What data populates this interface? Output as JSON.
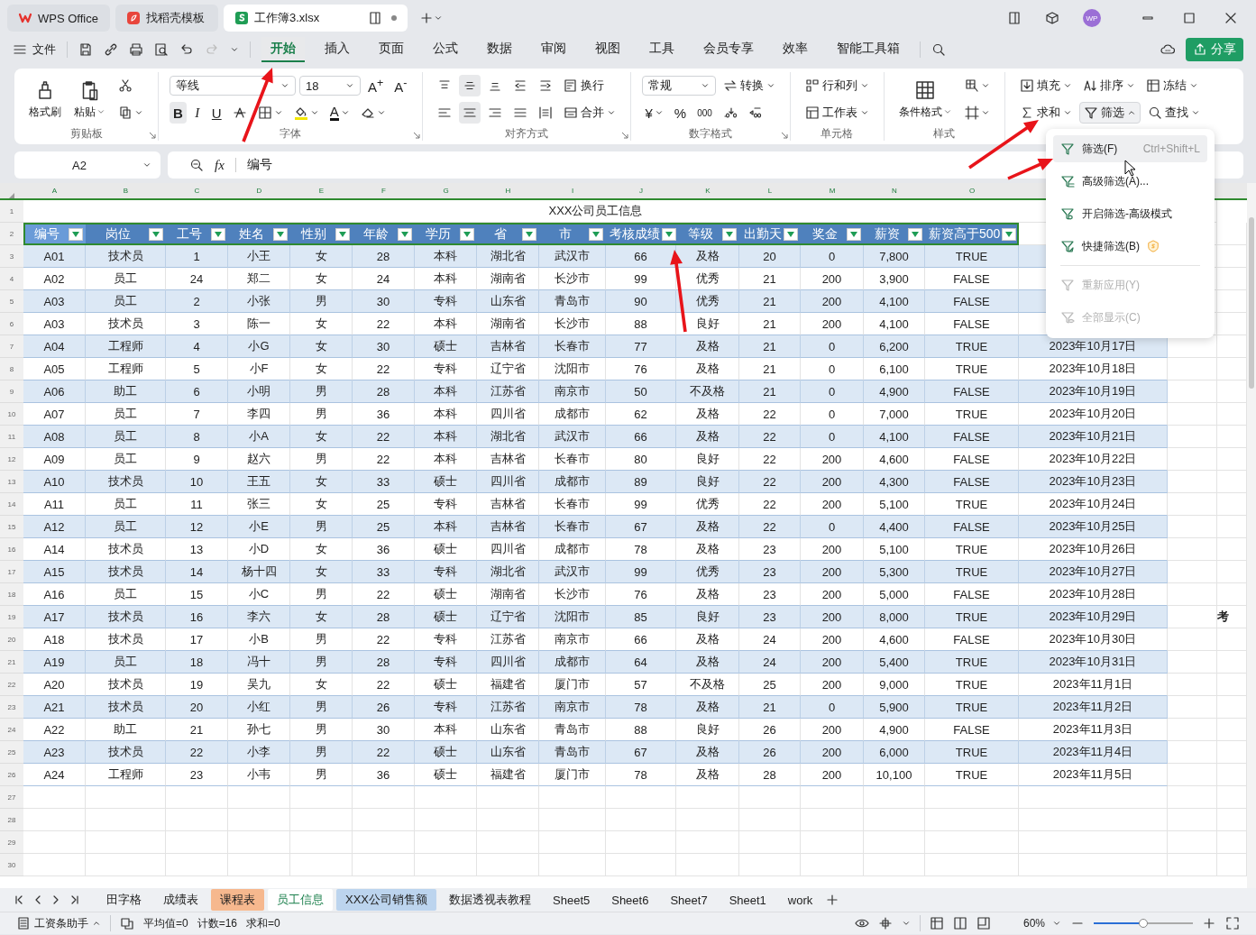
{
  "app_tabs": [
    {
      "kind": "wps",
      "label": "WPS Office",
      "selected": false
    },
    {
      "kind": "template",
      "label": "找稻壳模板",
      "selected": false
    },
    {
      "kind": "sheet",
      "label": "工作簿3.xlsx",
      "selected": true
    }
  ],
  "account": {
    "avatar": "WP"
  },
  "file_menu": "文件",
  "tabs": [
    {
      "label": "开始",
      "selected": true
    },
    {
      "label": "插入",
      "selected": false
    },
    {
      "label": "页面",
      "selected": false
    },
    {
      "label": "公式",
      "selected": false
    },
    {
      "label": "数据",
      "selected": false
    },
    {
      "label": "审阅",
      "selected": false
    },
    {
      "label": "视图",
      "selected": false
    },
    {
      "label": "工具",
      "selected": false
    },
    {
      "label": "会员专享",
      "selected": false
    },
    {
      "label": "效率",
      "selected": false
    },
    {
      "label": "智能工具箱",
      "selected": false
    }
  ],
  "share": "分享",
  "ribbon": {
    "clipboard": {
      "label": "剪贴板",
      "format_painter": "格式刷",
      "paste": "粘贴"
    },
    "font": {
      "label": "字体",
      "font_name": "等线",
      "font_size": "18",
      "grow": "A$^{+}$",
      "shrink": "A$^{-}$",
      "styles": [
        {
          "label": "B",
          "selected": true
        },
        {
          "label": "I",
          "selected": false
        },
        {
          "label": "U",
          "selected": false
        }
      ],
      "font_color": "A"
    },
    "alignment": {
      "label": "对齐方式",
      "buttons": [
        {
          "selected": false
        },
        {
          "selected": true
        },
        {
          "selected": false
        },
        {
          "selected": false
        },
        {
          "selected": false
        },
        {
          "selected": false
        },
        {
          "selected": true
        },
        {
          "selected": false
        },
        {
          "selected": false
        },
        {
          "selected": false
        }
      ],
      "wrap": "换行",
      "merge": "合并"
    },
    "number": {
      "label": "数字格式",
      "format": "常规",
      "convert": "转换",
      "currency": "¥",
      "percent": "%",
      "thousands": "000"
    },
    "cells": {
      "label": "单元格",
      "rows_cols": "行和列",
      "sheet": "工作表"
    },
    "styles": {
      "label": "样式",
      "conditional": "条件格式"
    },
    "editing": [
      {
        "label": "填充",
        "expanded": false
      },
      {
        "label": "排序",
        "expanded": false
      },
      {
        "label": "冻结",
        "expanded": false
      },
      {
        "label": "求和",
        "expanded": false
      },
      {
        "label": "筛选",
        "expanded": true
      },
      {
        "label": "查找",
        "expanded": false
      }
    ]
  },
  "formula_bar": {
    "cell": "A2",
    "fx": "fx",
    "value": "编号"
  },
  "sheet": {
    "title": "XXX公司员工信息",
    "columns": [
      "A",
      "B",
      "C",
      "D",
      "E",
      "F",
      "G",
      "H",
      "I",
      "J",
      "K",
      "L",
      "M",
      "N",
      "O"
    ],
    "row_numbers": [
      "1",
      "2",
      "3",
      "4",
      "5",
      "6",
      "7",
      "8",
      "9",
      "10",
      "11",
      "12",
      "13",
      "14",
      "15",
      "16",
      "17",
      "18",
      "19",
      "20",
      "21",
      "22",
      "23",
      "24",
      "25",
      "26",
      "27",
      "28",
      "29",
      "30"
    ],
    "headers": [
      "编号",
      "岗位",
      "工号",
      "姓名",
      "性别",
      "年龄",
      "学历",
      "省",
      "市",
      "考核成绩",
      "等级",
      "出勤天",
      "奖金",
      "薪资",
      "薪资高于500"
    ],
    "rows": [
      {
        "cells": [
          "A01",
          "技术员",
          "1",
          "小王",
          "女",
          "28",
          "本科",
          "湖北省",
          "武汉市",
          "66",
          "及格",
          "20",
          "0",
          "7,800",
          "TRUE"
        ]
      },
      {
        "cells": [
          "A02",
          "员工",
          "24",
          "郑二",
          "女",
          "24",
          "本科",
          "湖南省",
          "长沙市",
          "99",
          "优秀",
          "21",
          "200",
          "3,900",
          "FALSE"
        ]
      },
      {
        "cells": [
          "A03",
          "员工",
          "2",
          "小张",
          "男",
          "30",
          "专科",
          "山东省",
          "青岛市",
          "90",
          "优秀",
          "21",
          "200",
          "4,100",
          "FALSE"
        ]
      },
      {
        "cells": [
          "A03",
          "技术员",
          "3",
          "陈一",
          "女",
          "22",
          "本科",
          "湖南省",
          "长沙市",
          "88",
          "良好",
          "21",
          "200",
          "4,100",
          "FALSE"
        ]
      },
      {
        "cells": [
          "A04",
          "工程师",
          "4",
          "小G",
          "女",
          "30",
          "硕士",
          "吉林省",
          "长春市",
          "77",
          "及格",
          "21",
          "0",
          "6,200",
          "TRUE"
        ],
        "date": "2023年10月17日"
      },
      {
        "cells": [
          "A05",
          "工程师",
          "5",
          "小F",
          "女",
          "22",
          "专科",
          "辽宁省",
          "沈阳市",
          "76",
          "及格",
          "21",
          "0",
          "6,100",
          "TRUE"
        ],
        "date": "2023年10月18日"
      },
      {
        "cells": [
          "A06",
          "助工",
          "6",
          "小明",
          "男",
          "28",
          "本科",
          "江苏省",
          "南京市",
          "50",
          "不及格",
          "21",
          "0",
          "4,900",
          "FALSE"
        ],
        "date": "2023年10月19日"
      },
      {
        "cells": [
          "A07",
          "员工",
          "7",
          "李四",
          "男",
          "36",
          "本科",
          "四川省",
          "成都市",
          "62",
          "及格",
          "22",
          "0",
          "7,000",
          "TRUE"
        ],
        "date": "2023年10月20日"
      },
      {
        "cells": [
          "A08",
          "员工",
          "8",
          "小A",
          "女",
          "22",
          "本科",
          "湖北省",
          "武汉市",
          "66",
          "及格",
          "22",
          "0",
          "4,100",
          "FALSE"
        ],
        "date": "2023年10月21日"
      },
      {
        "cells": [
          "A09",
          "员工",
          "9",
          "赵六",
          "男",
          "22",
          "本科",
          "吉林省",
          "长春市",
          "80",
          "良好",
          "22",
          "200",
          "4,600",
          "FALSE"
        ],
        "date": "2023年10月22日"
      },
      {
        "cells": [
          "A10",
          "技术员",
          "10",
          "王五",
          "女",
          "33",
          "硕士",
          "四川省",
          "成都市",
          "89",
          "良好",
          "22",
          "200",
          "4,300",
          "FALSE"
        ],
        "date": "2023年10月23日"
      },
      {
        "cells": [
          "A11",
          "员工",
          "11",
          "张三",
          "女",
          "25",
          "专科",
          "吉林省",
          "长春市",
          "99",
          "优秀",
          "22",
          "200",
          "5,100",
          "TRUE"
        ],
        "date": "2023年10月24日"
      },
      {
        "cells": [
          "A12",
          "员工",
          "12",
          "小E",
          "男",
          "25",
          "本科",
          "吉林省",
          "长春市",
          "67",
          "及格",
          "22",
          "0",
          "4,400",
          "FALSE"
        ],
        "date": "2023年10月25日"
      },
      {
        "cells": [
          "A14",
          "技术员",
          "13",
          "小D",
          "女",
          "36",
          "硕士",
          "四川省",
          "成都市",
          "78",
          "及格",
          "23",
          "200",
          "5,100",
          "TRUE"
        ],
        "date": "2023年10月26日"
      },
      {
        "cells": [
          "A15",
          "技术员",
          "14",
          "杨十四",
          "女",
          "33",
          "专科",
          "湖北省",
          "武汉市",
          "99",
          "优秀",
          "23",
          "200",
          "5,300",
          "TRUE"
        ],
        "date": "2023年10月27日"
      },
      {
        "cells": [
          "A16",
          "员工",
          "15",
          "小C",
          "男",
          "22",
          "硕士",
          "湖南省",
          "长沙市",
          "76",
          "及格",
          "23",
          "200",
          "5,000",
          "FALSE"
        ],
        "date": "2023年10月28日"
      },
      {
        "cells": [
          "A17",
          "技术员",
          "16",
          "李六",
          "女",
          "28",
          "硕士",
          "辽宁省",
          "沈阳市",
          "85",
          "良好",
          "23",
          "200",
          "8,000",
          "TRUE"
        ],
        "date": "2023年10月29日",
        "column_r": "考"
      },
      {
        "cells": [
          "A18",
          "技术员",
          "17",
          "小B",
          "男",
          "22",
          "专科",
          "江苏省",
          "南京市",
          "66",
          "及格",
          "24",
          "200",
          "4,600",
          "FALSE"
        ],
        "date": "2023年10月30日"
      },
      {
        "cells": [
          "A19",
          "员工",
          "18",
          "冯十",
          "男",
          "28",
          "专科",
          "四川省",
          "成都市",
          "64",
          "及格",
          "24",
          "200",
          "5,400",
          "TRUE"
        ],
        "date": "2023年10月31日"
      },
      {
        "cells": [
          "A20",
          "技术员",
          "19",
          "吴九",
          "女",
          "22",
          "硕士",
          "福建省",
          "厦门市",
          "57",
          "不及格",
          "25",
          "200",
          "9,000",
          "TRUE"
        ],
        "date": "2023年11月1日"
      },
      {
        "cells": [
          "A21",
          "技术员",
          "20",
          "小红",
          "男",
          "26",
          "专科",
          "江苏省",
          "南京市",
          "78",
          "及格",
          "21",
          "0",
          "5,900",
          "TRUE"
        ],
        "date": "2023年11月2日"
      },
      {
        "cells": [
          "A22",
          "助工",
          "21",
          "孙七",
          "男",
          "30",
          "本科",
          "山东省",
          "青岛市",
          "88",
          "良好",
          "26",
          "200",
          "4,900",
          "FALSE"
        ],
        "date": "2023年11月3日"
      },
      {
        "cells": [
          "A23",
          "技术员",
          "22",
          "小李",
          "男",
          "22",
          "硕士",
          "山东省",
          "青岛市",
          "67",
          "及格",
          "26",
          "200",
          "6,000",
          "TRUE"
        ],
        "date": "2023年11月4日"
      },
      {
        "cells": [
          "A24",
          "工程师",
          "23",
          "小韦",
          "男",
          "36",
          "硕士",
          "福建省",
          "厦门市",
          "78",
          "及格",
          "28",
          "200",
          "10,100",
          "TRUE"
        ],
        "date": "2023年11月5日"
      }
    ]
  },
  "filter_menu": {
    "items": [
      {
        "kind": "item",
        "label": "筛选(F)",
        "shortcut": "Ctrl+Shift+L",
        "highlighted": true,
        "disabled": false,
        "premium": false
      },
      {
        "kind": "item",
        "label": "高级筛选(A)...",
        "highlighted": false,
        "disabled": false,
        "premium": false
      },
      {
        "kind": "item",
        "label": "开启筛选-高级模式",
        "highlighted": false,
        "disabled": false,
        "premium": false
      },
      {
        "kind": "item",
        "label": "快捷筛选(B)",
        "highlighted": false,
        "disabled": false,
        "premium": true
      },
      {
        "kind": "separator"
      },
      {
        "kind": "item",
        "label": "重新应用(Y)",
        "highlighted": false,
        "disabled": true,
        "premium": false
      },
      {
        "kind": "item",
        "label": "全部显示(C)",
        "highlighted": false,
        "disabled": true,
        "premium": false
      }
    ]
  },
  "sheet_tabs": [
    {
      "label": "田字格",
      "selected": false
    },
    {
      "label": "成绩表",
      "selected": false
    },
    {
      "label": "课程表",
      "selected": false,
      "color": "#f6b88e"
    },
    {
      "label": "员工信息",
      "selected": true
    },
    {
      "label": "XXX公司销售额",
      "selected": false,
      "color": "#bcd4ee"
    },
    {
      "label": "数据透视表教程",
      "selected": false
    },
    {
      "label": "Sheet5",
      "selected": false
    },
    {
      "label": "Sheet6",
      "selected": false
    },
    {
      "label": "Sheet7",
      "selected": false
    },
    {
      "label": "Sheet1",
      "selected": false
    },
    {
      "label": "work",
      "selected": false
    }
  ],
  "status_bar": {
    "helper": "工资条助手",
    "stats": [
      "平均值=0",
      "计数=16",
      "求和=0"
    ],
    "zoom": "60%",
    "zoom_slider": {
      "level": 0.5
    }
  }
}
